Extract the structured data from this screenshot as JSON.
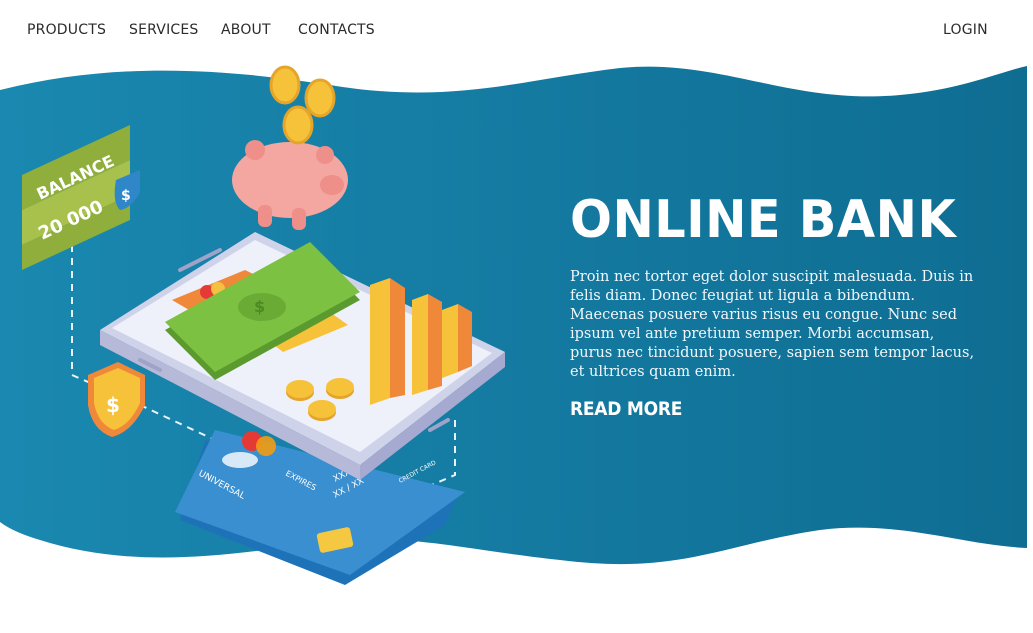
{
  "nav": {
    "products": "PRODUCTS",
    "services": "SERVICES",
    "about": "ABOUT",
    "contacts": "CONTACTS",
    "login": "LOGIN"
  },
  "hero": {
    "title": "ONLINE BANK",
    "body": "Proin nec tortor eget dolor suscipit malesuada. Duis in felis diam. Donec feugiat ut ligula a bibendum. Maecenas posuere varius risus eu congue. Nunc sed ipsum vel ante pretium semper. Morbi accumsan, purus nec tincidunt posuere, sapien sem tempor lacus, et ultrices quam enim.",
    "cta": "READ MORE"
  },
  "illustration": {
    "balance_label": "BALANCE",
    "balance_value": "20 000",
    "dollar_sign": "$",
    "card_brand": "UNIVERSAL",
    "card_expires": "EXPIRES",
    "card_expiry_value": "XX / XX",
    "card_number": "XXX   XXXX   XXXX",
    "card_type": "CREDIT CARD"
  },
  "colors": {
    "wave": "#157fa4",
    "wave_dark": "#0f6b8f",
    "coin": "#f6c23a",
    "cash": "#7cc142",
    "banner": "#8fae3c",
    "card": "#3a8fd0"
  }
}
